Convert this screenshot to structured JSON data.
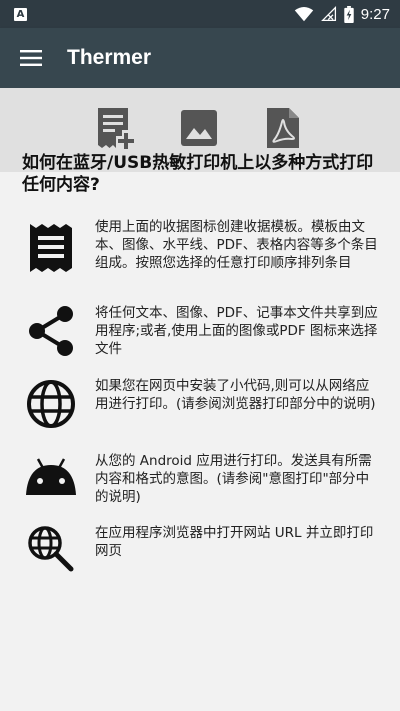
{
  "status_bar": {
    "notification_badge": "A",
    "time": "9:27"
  },
  "app_bar": {
    "title": "Thermer"
  },
  "toolbar": {
    "buttons": [
      {
        "icon": "receipt-add-icon"
      },
      {
        "icon": "image-icon"
      },
      {
        "icon": "pdf-file-icon"
      }
    ]
  },
  "main": {
    "heading": "如何在蓝牙/USB热敏打印机上以多种方式打印任何内容?",
    "items": [
      {
        "icon": "receipt-icon",
        "text": "使用上面的收据图标创建收据模板。模板由文本、图像、水平线、PDF、表格内容等多个条目组成。按照您选择的任意打印顺序排列条目"
      },
      {
        "icon": "share-icon",
        "text": "将任何文本、图像、PDF、记事本文件共享到应用程序;或者,使用上面的图像或PDF 图标来选择文件"
      },
      {
        "icon": "globe-icon",
        "text": "如果您在网页中安装了小代码,则可以从网络应用进行打印。(请参阅浏览器打印部分中的说明)"
      },
      {
        "icon": "android-icon",
        "text": "从您的 Android 应用进行打印。发送具有所需内容和格式的意图。(请参阅\"意图打印\"部分中的说明)"
      },
      {
        "icon": "web-search-icon",
        "text": "在应用程序浏览器中打开网站 URL 并立即打印网页"
      }
    ]
  }
}
